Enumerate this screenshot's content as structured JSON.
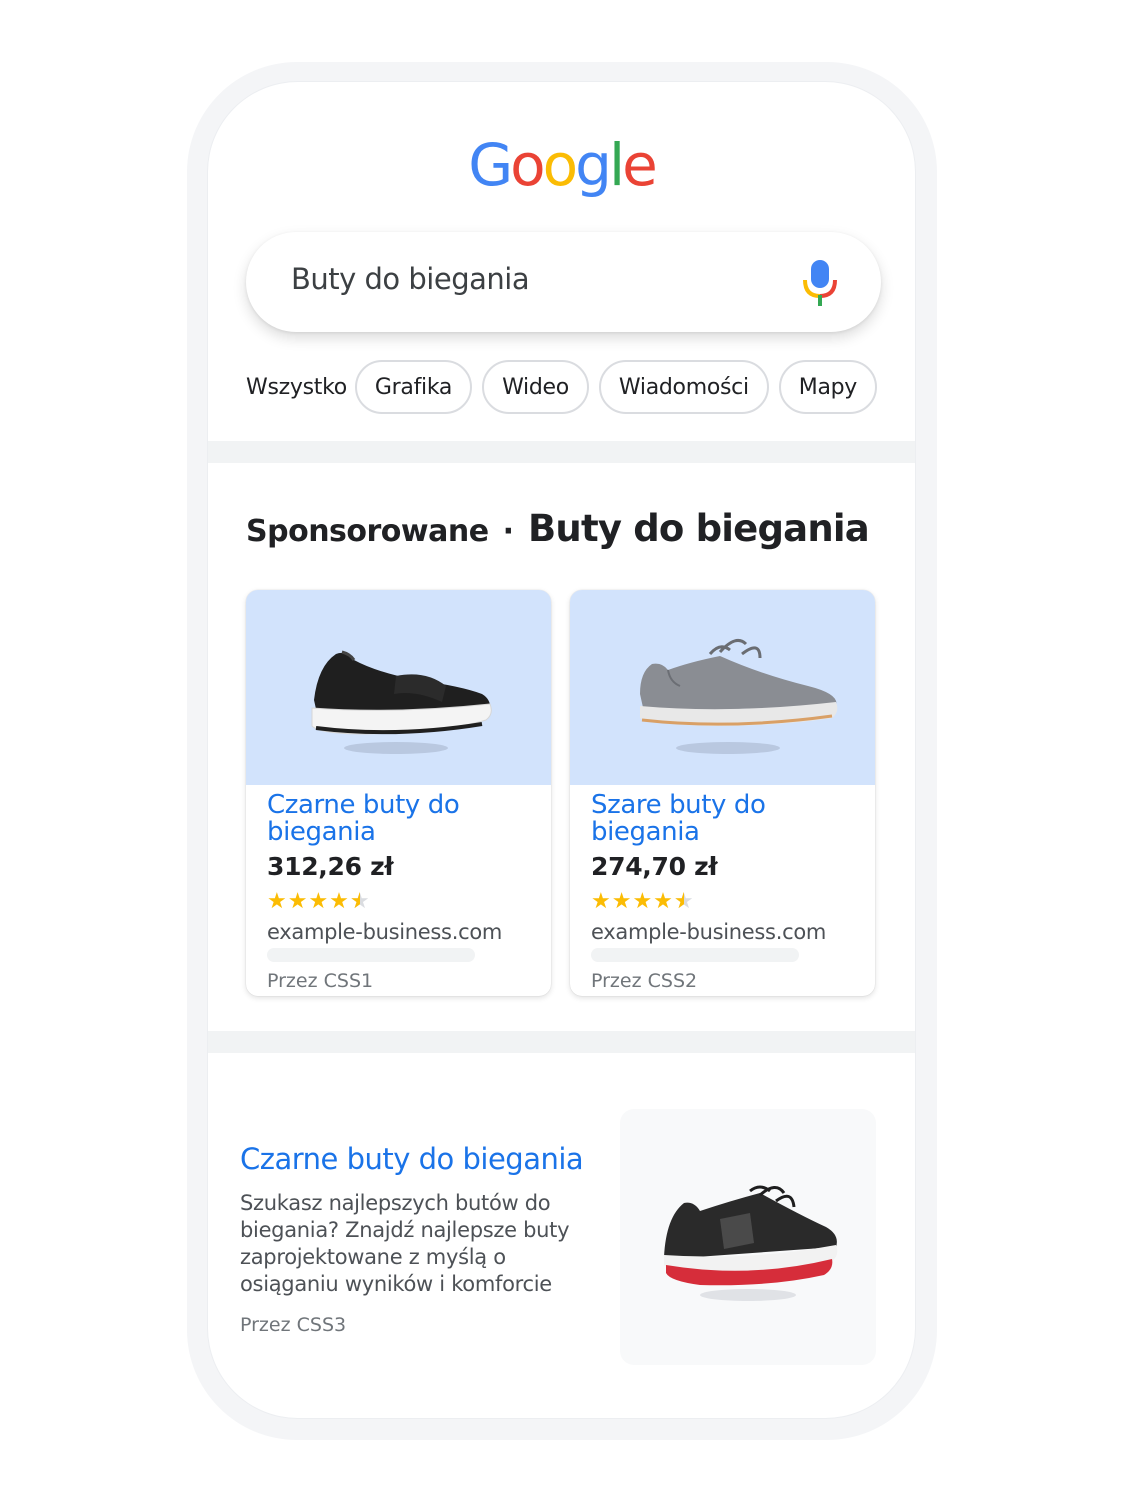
{
  "logo": {
    "letters": [
      {
        "char": "G",
        "color": "#4285f4"
      },
      {
        "char": "o",
        "color": "#ea4335"
      },
      {
        "char": "o",
        "color": "#fbbc04"
      },
      {
        "char": "g",
        "color": "#4285f4"
      },
      {
        "char": "l",
        "color": "#34a853"
      },
      {
        "char": "e",
        "color": "#ea4335"
      }
    ]
  },
  "search": {
    "query": "Buty do biegania",
    "mic_icon": "microphone-icon"
  },
  "filters": {
    "all": "Wszystko",
    "chips": [
      "Grafika",
      "Wideo",
      "Wiadomości",
      "Mapy"
    ]
  },
  "sponsored": {
    "label": "Sponsorowane",
    "separator": "·",
    "query": "Buty do biegania",
    "products": [
      {
        "title": "Czarne buty do biegania",
        "price": "312,26 zł",
        "rating": 4.5,
        "domain": "example-business.com",
        "by": "Przez CSS1",
        "image_icon": "black-running-shoe"
      },
      {
        "title": "Szare buty do biegania",
        "price": "274,70 zł",
        "rating": 4.5,
        "domain": "example-business.com",
        "by": "Przez CSS2",
        "image_icon": "gray-running-shoe"
      }
    ]
  },
  "organic": {
    "title": "Czarne buty do biegania",
    "description": "Szukasz najlepszych butów do biegania? Znajdź najlepsze buty zaprojektowane z myślą o osiąganiu wyników i komforcie",
    "by": "Przez CSS3",
    "image_icon": "black-red-running-shoe"
  },
  "colors": {
    "link": "#1a73e8",
    "star": "#fbbc04",
    "card_image_bg": "#d2e3fc"
  }
}
